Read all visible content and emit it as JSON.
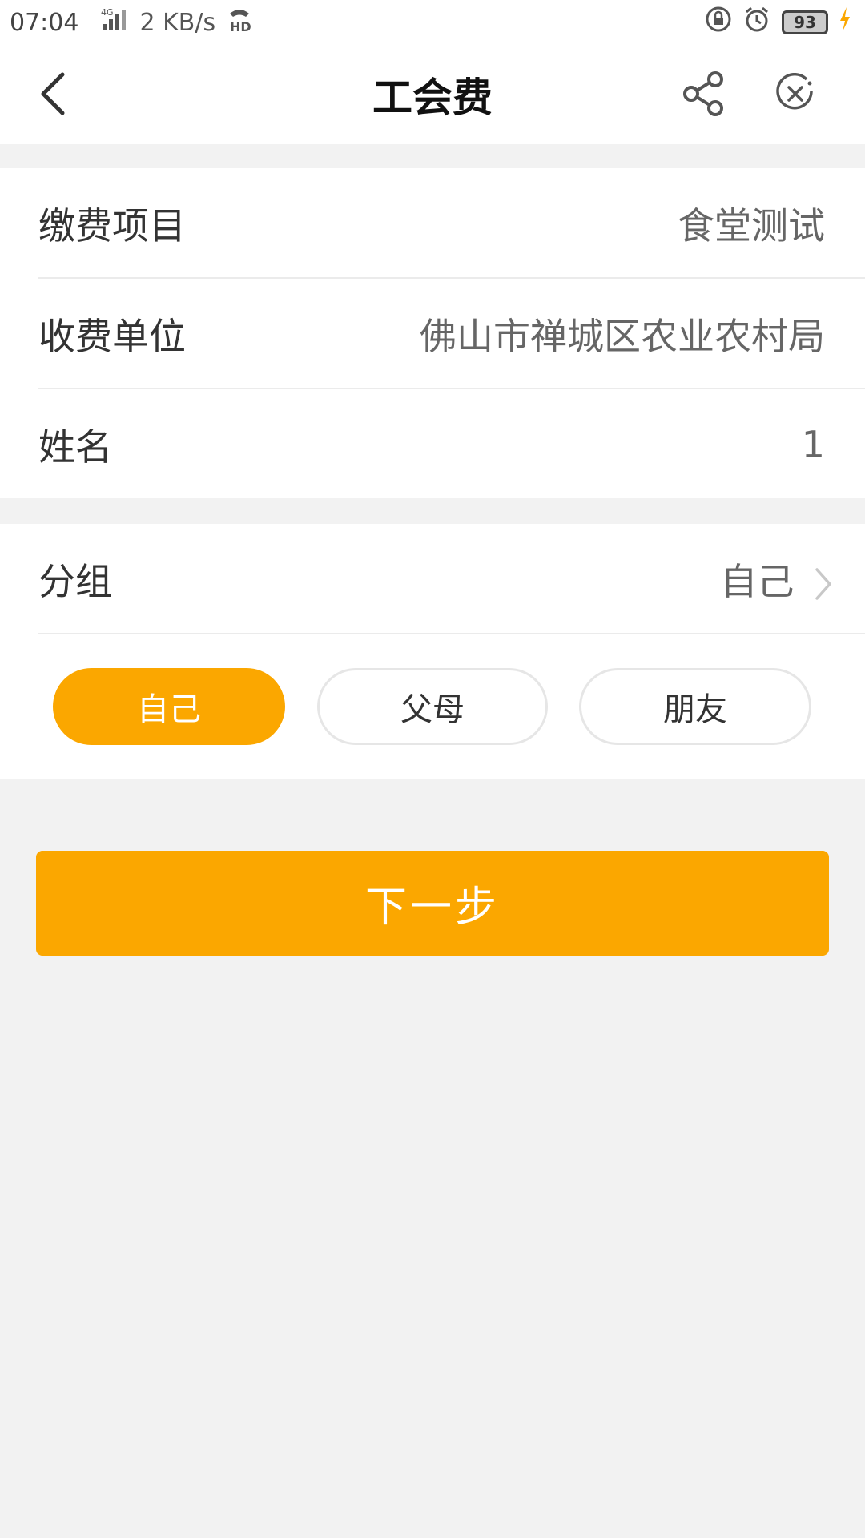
{
  "status_bar": {
    "time": "07:04",
    "network_type": "4G",
    "speed": "2 KB/s",
    "hd_badge": "HD",
    "battery": "93"
  },
  "header": {
    "title": "工会费",
    "back_icon": "chevron-left-icon",
    "share_icon": "share-icon",
    "close_icon": "close-circle-icon"
  },
  "details": {
    "rows": [
      {
        "label": "缴费项目",
        "value": "食堂测试"
      },
      {
        "label": "收费单位",
        "value": "佛山市禅城区农业农村局"
      },
      {
        "label": "姓名",
        "value": "1"
      }
    ]
  },
  "group": {
    "label": "分组",
    "value": "自己",
    "options": [
      {
        "label": "自己",
        "selected": true
      },
      {
        "label": "父母",
        "selected": false
      },
      {
        "label": "朋友",
        "selected": false
      }
    ]
  },
  "actions": {
    "next_label": "下一步"
  },
  "colors": {
    "accent": "#fba700",
    "background": "#f2f2f2",
    "surface": "#ffffff"
  }
}
